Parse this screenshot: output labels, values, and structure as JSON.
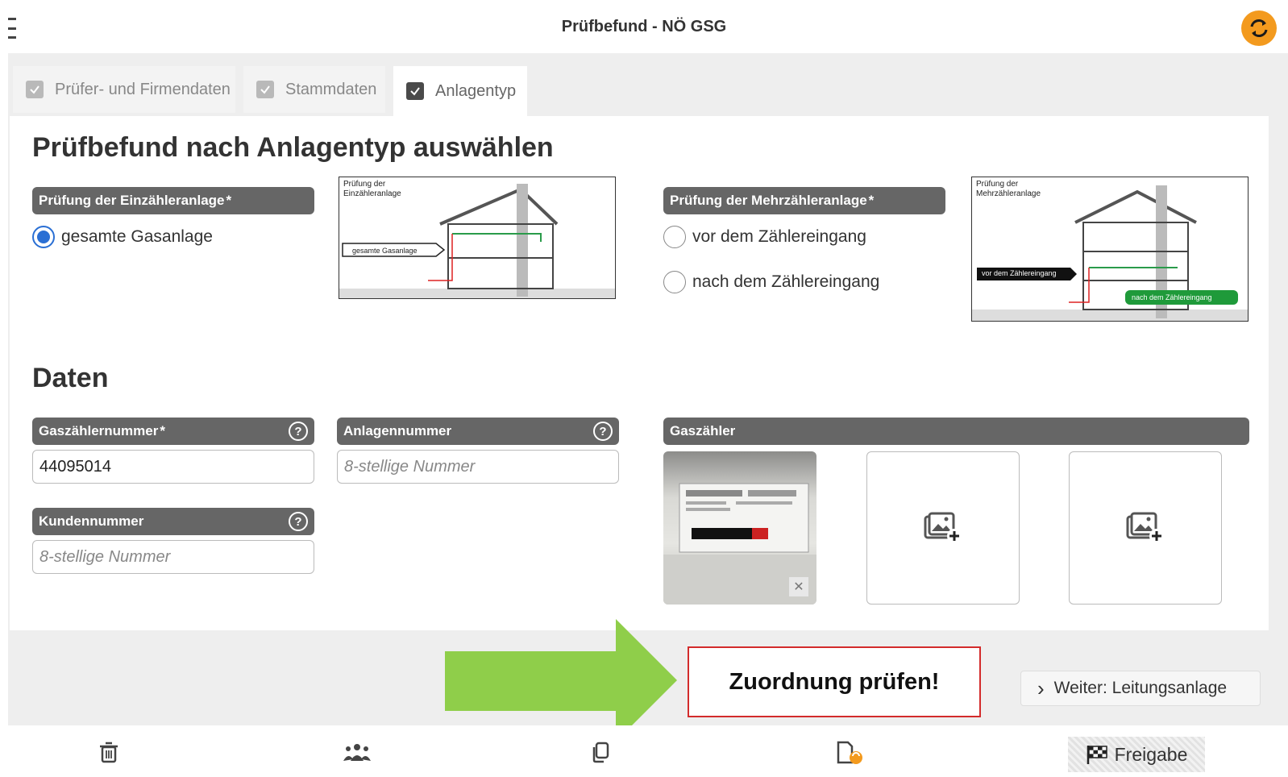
{
  "app": {
    "title": "Prüfbefund - NÖ GSG"
  },
  "tabs": [
    {
      "label": "Prüfer- und Firmendaten",
      "checked": true,
      "active": false
    },
    {
      "label": "Stammdaten",
      "checked": true,
      "active": false
    },
    {
      "label": "Anlagentyp",
      "checked": true,
      "active": true
    }
  ],
  "section_select": {
    "heading": "Prüfbefund nach Anlagentyp auswählen",
    "einzel": {
      "label": "Prüfung der Einzähleranlage",
      "required_mark": "*",
      "options": [
        {
          "label": "gesamte Gasanlage",
          "selected": true
        }
      ],
      "diagram_title_1": "Prüfung der",
      "diagram_title_2": "Einzähleranlage",
      "diagram_tag": "gesamte Gasanlage"
    },
    "mehr": {
      "label": "Prüfung der Mehrzähleranlage",
      "required_mark": "*",
      "options": [
        {
          "label": "vor dem Zählereingang",
          "selected": false
        },
        {
          "label": "nach dem Zählereingang",
          "selected": false
        }
      ],
      "diagram_title_1": "Prüfung der",
      "diagram_title_2": "Mehrzähleranlage",
      "diagram_tag_vor": "vor dem Zählereingang",
      "diagram_tag_nach": "nach dem Zählereingang"
    }
  },
  "section_daten": {
    "heading": "Daten",
    "gaszaehlernummer": {
      "label": "Gaszählernummer",
      "required_mark": "*",
      "value": "44095014"
    },
    "anlagennummer": {
      "label": "Anlagennummer",
      "placeholder": "8-stellige Nummer"
    },
    "kundennummer": {
      "label": "Kundennummer",
      "placeholder": "8-stellige Nummer"
    },
    "help_glyph": "?",
    "gaszaehler": {
      "label": "Gaszähler",
      "remove_glyph": "✕"
    }
  },
  "callout": {
    "text": "Zuordnung prüfen!"
  },
  "next_button": {
    "chevron": "›",
    "label": "Weiter: Leitungsanlage"
  },
  "bottom_bar": {
    "icons": [
      "trash-icon",
      "users-icon",
      "copy-icon",
      "pdf-sync-icon"
    ],
    "freigabe_label": "Freigabe"
  },
  "colors": {
    "accent_orange": "#f39a1e",
    "radio_blue": "#2a6fd4",
    "label_bar_gray": "#666666",
    "callout_red": "#d32b2b",
    "arrow_green": "#8fce4a"
  }
}
